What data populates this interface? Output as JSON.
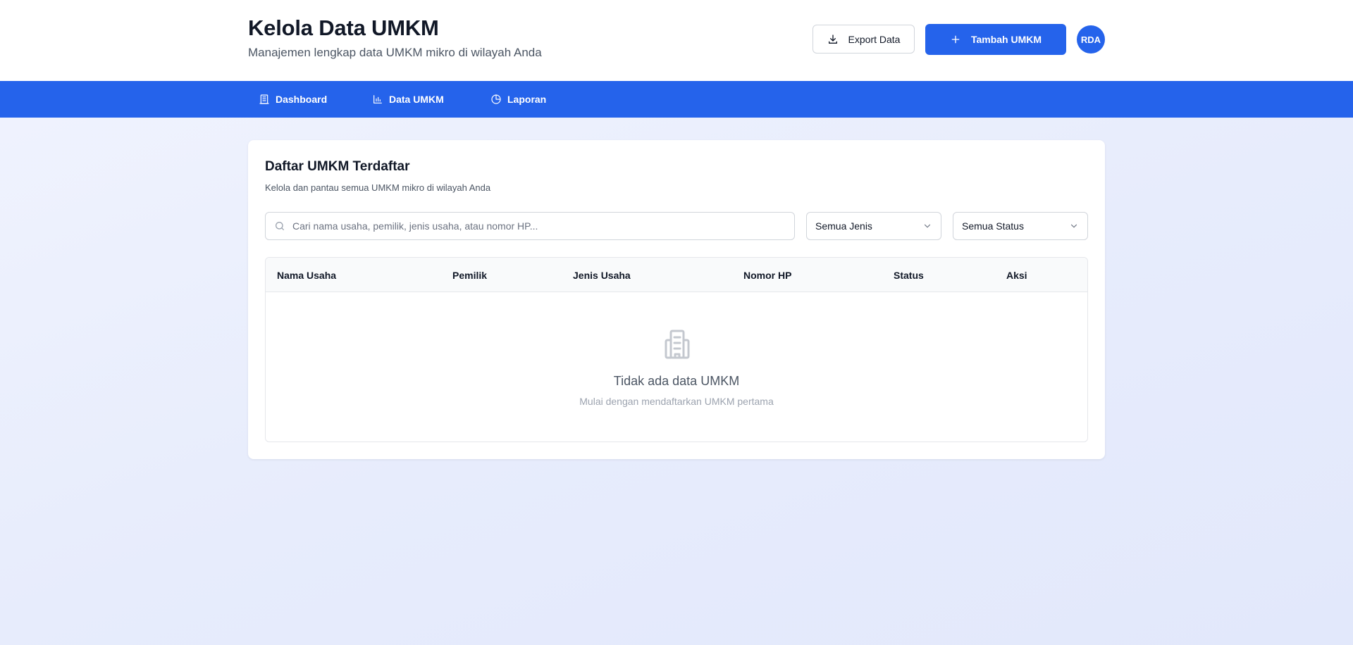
{
  "header": {
    "title": "Kelola Data UMKM",
    "subtitle": "Manajemen lengkap data UMKM mikro di wilayah Anda",
    "export_label": "Export Data",
    "add_label": "Tambah UMKM",
    "avatar_initials": "RDA"
  },
  "nav": {
    "items": [
      {
        "label": "Dashboard",
        "icon": "building-icon"
      },
      {
        "label": "Data UMKM",
        "icon": "bar-chart-icon"
      },
      {
        "label": "Laporan",
        "icon": "pie-chart-icon"
      }
    ]
  },
  "card": {
    "title": "Daftar UMKM Terdaftar",
    "subtitle": "Kelola dan pantau semua UMKM mikro di wilayah Anda",
    "search_placeholder": "Cari nama usaha, pemilik, jenis usaha, atau nomor HP...",
    "search_value": "",
    "filter_type": "Semua Jenis",
    "filter_status": "Semua Status"
  },
  "table": {
    "columns": [
      "Nama Usaha",
      "Pemilik",
      "Jenis Usaha",
      "Nomor HP",
      "Status",
      "Aksi"
    ],
    "rows": []
  },
  "empty_state": {
    "title": "Tidak ada data UMKM",
    "subtitle": "Mulai dengan mendaftarkan UMKM pertama",
    "icon": "building-icon"
  },
  "colors": {
    "primary": "#2563eb",
    "text": "#111827",
    "muted": "#4b5563"
  }
}
